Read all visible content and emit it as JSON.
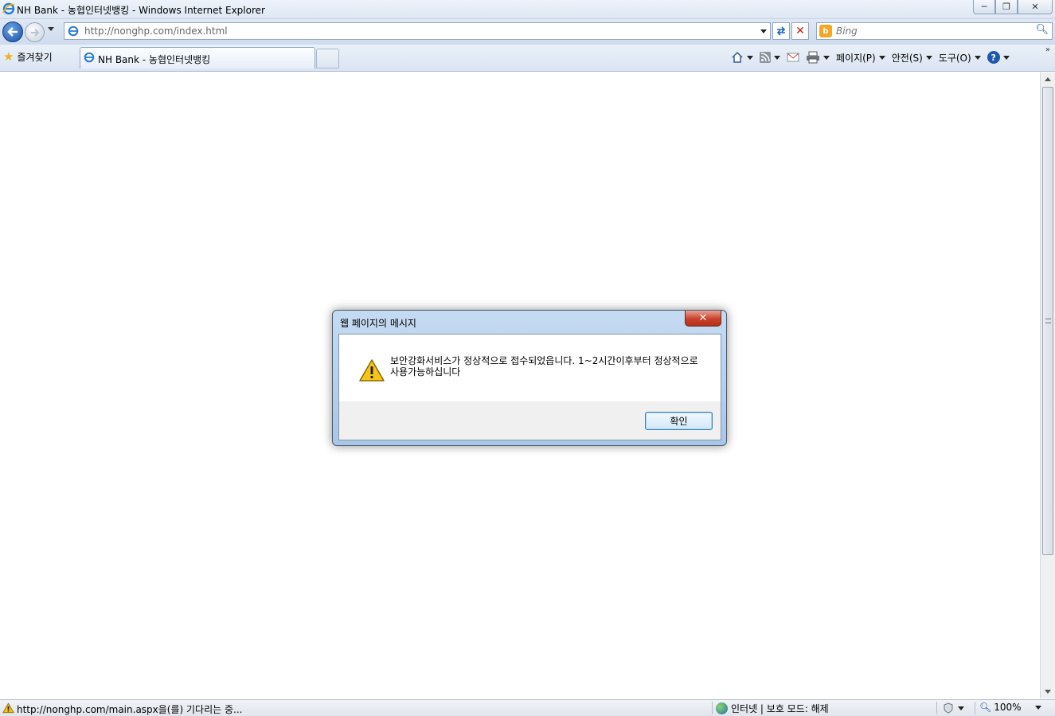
{
  "window": {
    "title": "NH Bank - 농협인터넷뱅킹 - Windows Internet Explorer"
  },
  "navbar": {
    "address": "http://nonghp.com/index.html",
    "search_placeholder": "Bing"
  },
  "cmdbar": {
    "favorites_label": "즐겨찾기",
    "tab_label": "NH Bank - 농협인터넷뱅킹",
    "page_menu": "페이지(P)",
    "safety_menu": "안전(S)",
    "tools_menu": "도구(O)"
  },
  "dialog": {
    "title": "웹 페이지의 메시지",
    "message": "보안강화서비스가 정상적으로 접수되었읍니다. 1~2시간이후부터 정상적으로 사용가능하십니다",
    "ok_label": "확인"
  },
  "statusbar": {
    "status_text": "http://nonghp.com/main.aspx을(를) 기다리는 중...",
    "zone_text": "인터넷 | 보호 모드: 해제",
    "zoom_text": "100%"
  },
  "colors": {
    "accent": "#1c4fa8",
    "close_red": "#c8412b",
    "warning_yellow": "#f7c51a"
  }
}
